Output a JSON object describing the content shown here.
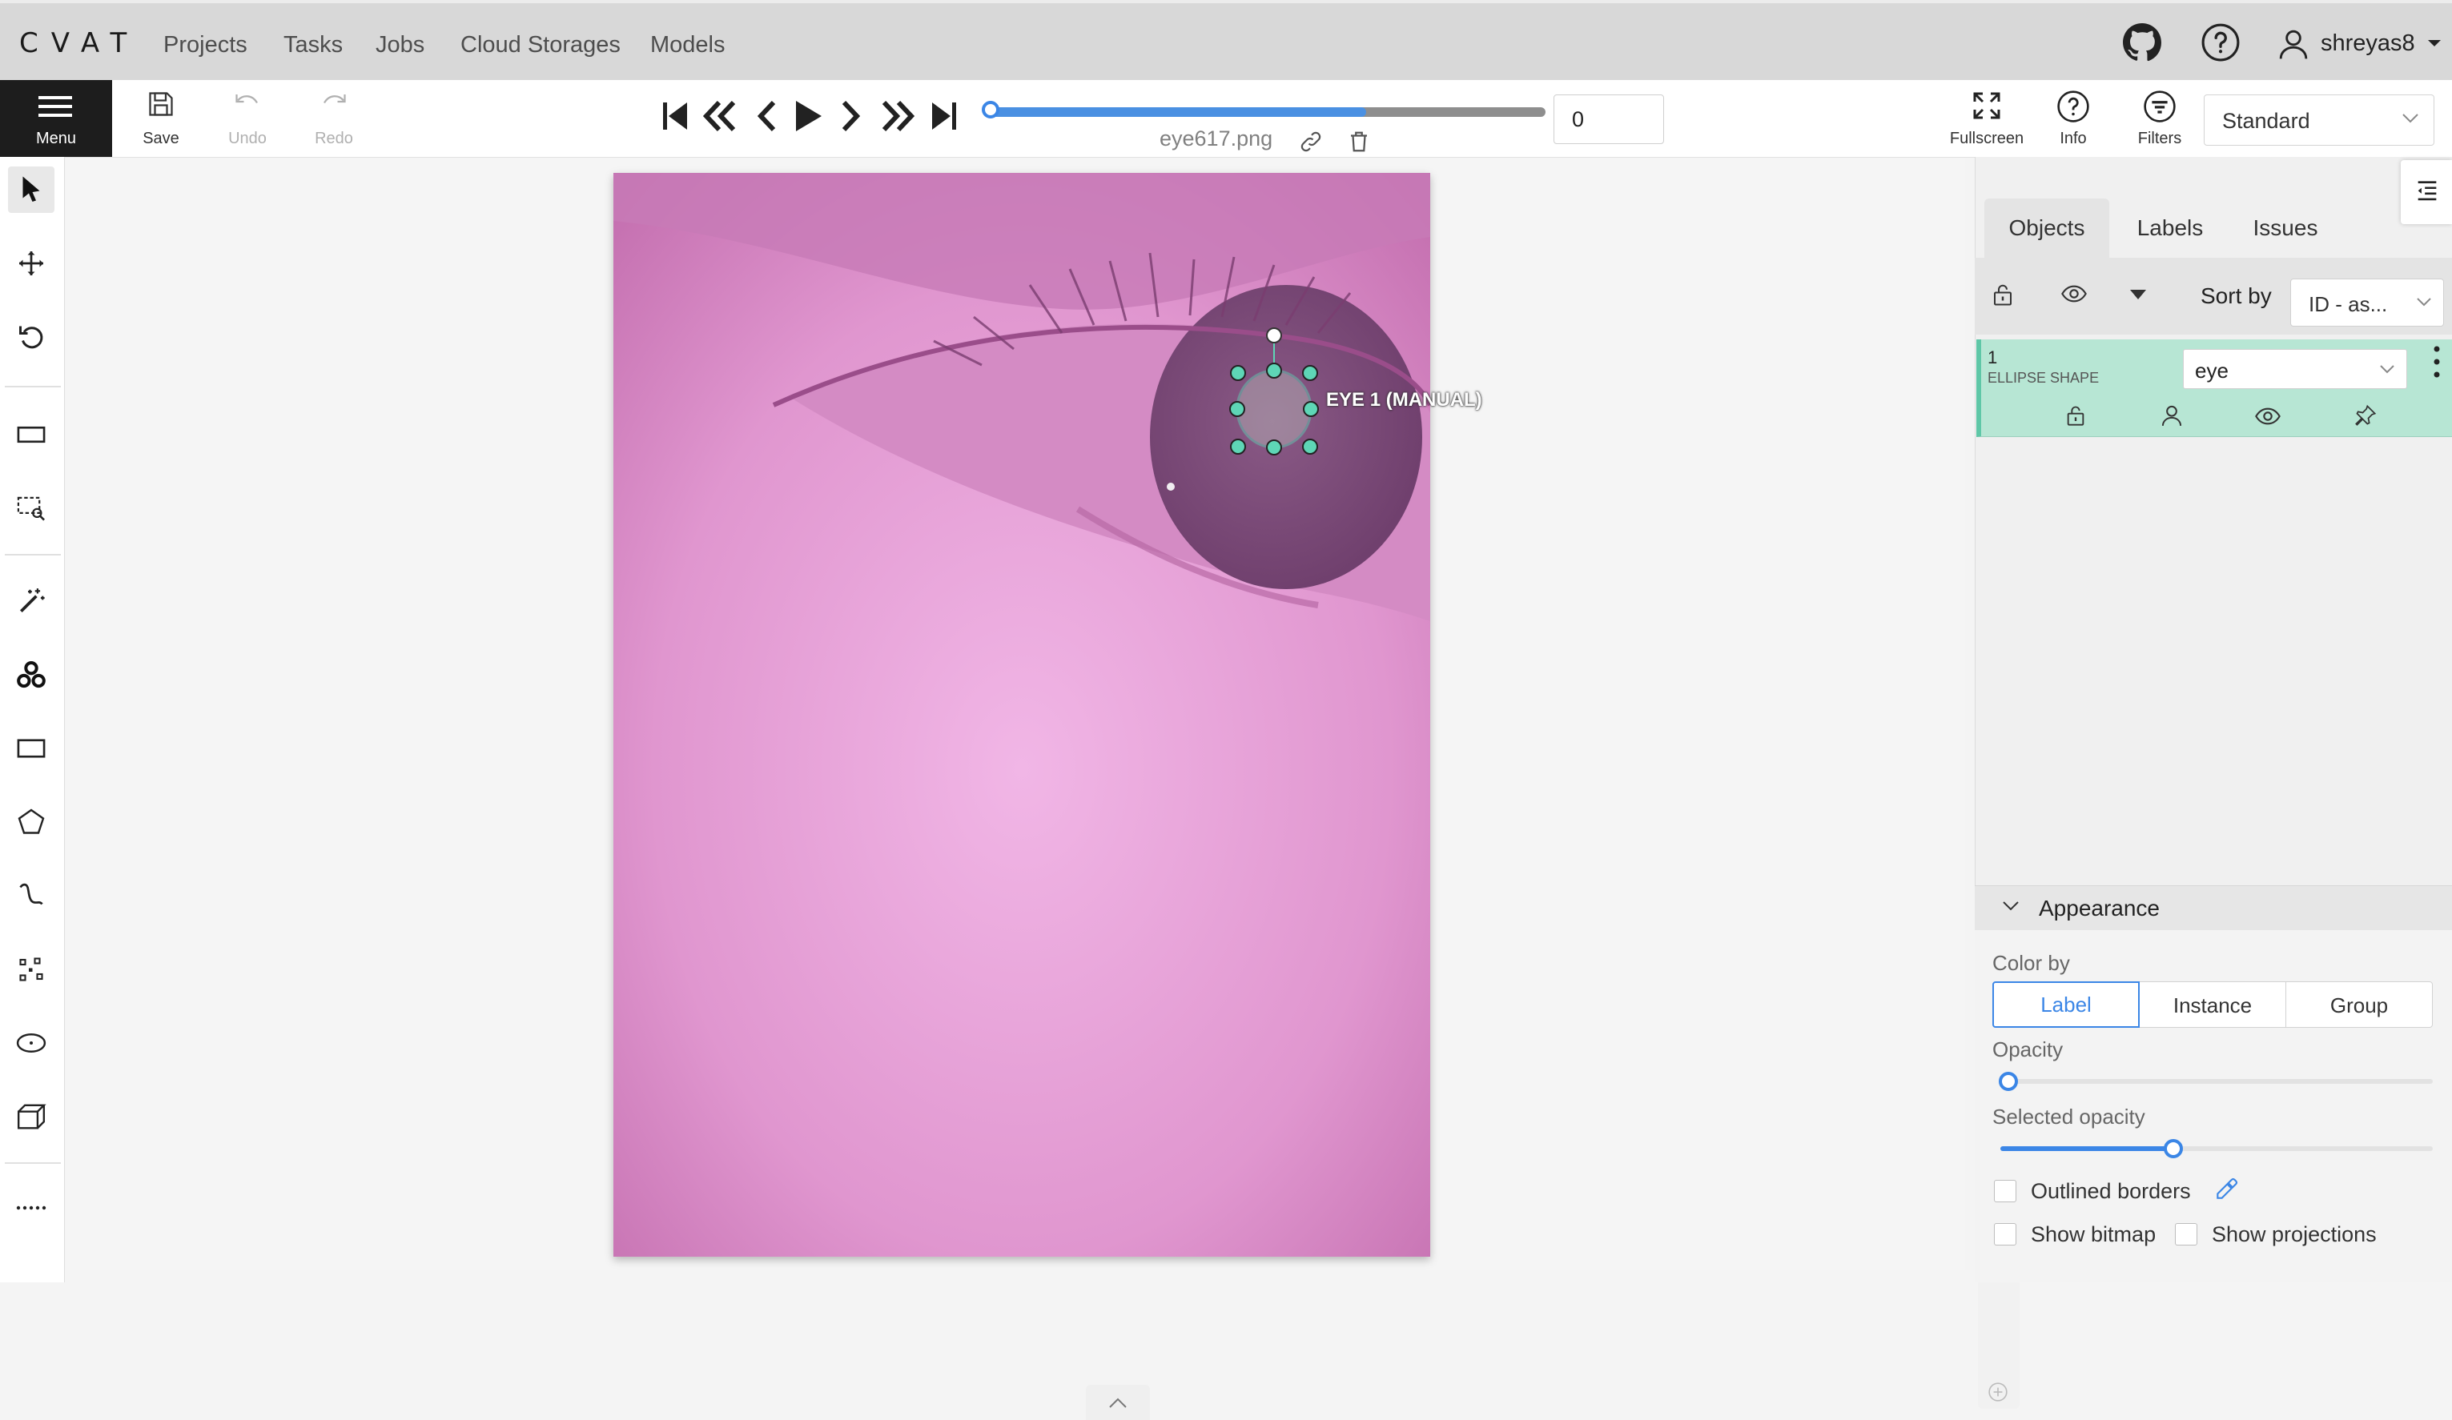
{
  "app": {
    "logo": "CVAT"
  },
  "nav": {
    "items": [
      "Projects",
      "Tasks",
      "Jobs",
      "Cloud Storages",
      "Models"
    ]
  },
  "user": {
    "name": "shreyas8",
    "icons": [
      "github-icon",
      "help-icon",
      "user-icon"
    ]
  },
  "toolbar": {
    "menu_label": "Menu",
    "save_label": "Save",
    "undo_label": "Undo",
    "redo_label": "Redo",
    "frame_number": "0",
    "frame_progress": 0.68,
    "filename": "eye617.png",
    "fullscreen_label": "Fullscreen",
    "info_label": "Info",
    "filters_label": "Filters",
    "workspace_value": "Standard"
  },
  "left_tools": [
    "cursor-icon",
    "move-icon",
    "rotate-icon",
    "fit-image-icon",
    "zoom-region-icon",
    "ai-tools-icon",
    "opencv-icon",
    "rectangle-icon",
    "polygon-icon",
    "polyline-icon",
    "points-icon",
    "ellipse-icon",
    "cuboid-icon",
    "more-icon"
  ],
  "canvas": {
    "annotation_label": "EYE 1 (MANUAL)",
    "annotation_color": "#5ed6b6"
  },
  "sidebar": {
    "tabs": [
      "Objects",
      "Labels",
      "Issues"
    ],
    "active_tab": "Objects",
    "sort_label": "Sort by",
    "sort_value": "ID - as...",
    "objects": [
      {
        "id": "1",
        "type": "ELLIPSE SHAPE",
        "label": "eye",
        "color": "#b7e6d4"
      }
    ],
    "appearance": {
      "title": "Appearance",
      "color_by_label": "Color by",
      "color_by_options": [
        "Label",
        "Instance",
        "Group"
      ],
      "color_by_selected": "Label",
      "opacity_label": "Opacity",
      "opacity_value": 0.0,
      "selected_opacity_label": "Selected opacity",
      "selected_opacity_value": 0.4,
      "outlined_borders_label": "Outlined borders",
      "show_bitmap_label": "Show bitmap",
      "show_projections_label": "Show projections"
    }
  },
  "colors": {
    "accent": "#3b86e6",
    "menu_bg": "#1d1d1d",
    "object_bg": "#b7e6d4"
  }
}
